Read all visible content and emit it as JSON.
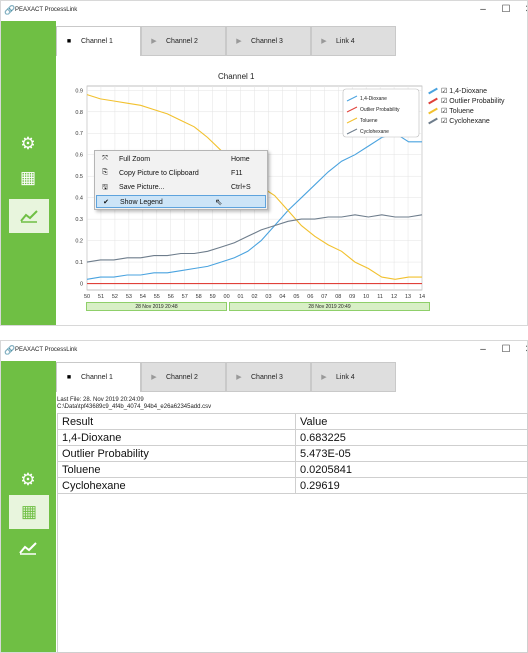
{
  "app_title": "PEAXACT ProcessLink",
  "window_controls": {
    "minimize": "–",
    "maximize": "☐",
    "close": "✕"
  },
  "sidebar": [
    {
      "name": "settings",
      "icon": "gear-icon",
      "glyph": "⚙"
    },
    {
      "name": "table",
      "icon": "table-icon",
      "glyph": "▦"
    },
    {
      "name": "chart",
      "icon": "chart-icon",
      "glyph": "⬈"
    }
  ],
  "tabs": [
    {
      "label": "Channel 1",
      "marker": "■"
    },
    {
      "label": "Channel 2",
      "marker": "▶"
    },
    {
      "label": "Channel 3",
      "marker": "▶"
    },
    {
      "label": "Link 4",
      "marker": "▶"
    }
  ],
  "chart_view": {
    "title": "Channel 1",
    "context_menu": [
      {
        "icon": "⤧",
        "label": "Full Zoom",
        "shortcut": "Home"
      },
      {
        "icon": "⎘",
        "label": "Copy Picture to Clipboard",
        "shortcut": "F11"
      },
      {
        "icon": "🖫",
        "label": "Save Picture...",
        "shortcut": "Ctrl+S"
      },
      {
        "icon": "✔",
        "label": "Show Legend",
        "shortcut": ""
      }
    ],
    "time_segments": [
      "28 Nov 2019 20:48",
      "28 Nov 2019 20:49"
    ],
    "side_legend_checkbox": "☑"
  },
  "chart_data": {
    "type": "line",
    "title": "Channel 1",
    "xlabel": "",
    "ylabel": "",
    "ylim": [
      -0.03,
      0.92
    ],
    "x_ticks": [
      "50",
      "51",
      "52",
      "53",
      "54",
      "55",
      "56",
      "57",
      "58",
      "59",
      "00",
      "01",
      "02",
      "03",
      "04",
      "05",
      "06",
      "07",
      "08",
      "09",
      "10",
      "11",
      "12",
      "13",
      "14"
    ],
    "y_ticks": [
      "0",
      "0.1",
      "0.2",
      "0.3",
      "0.4",
      "0.5",
      "0.6",
      "0.7",
      "0.8",
      "0.9"
    ],
    "grid": true,
    "legend_placement": "top-right",
    "series": [
      {
        "name": "1,4-Dioxane",
        "color": "#4aa3df",
        "values": [
          0.02,
          0.03,
          0.03,
          0.04,
          0.04,
          0.05,
          0.05,
          0.06,
          0.07,
          0.08,
          0.1,
          0.12,
          0.15,
          0.2,
          0.27,
          0.34,
          0.4,
          0.46,
          0.52,
          0.57,
          0.6,
          0.64,
          0.68,
          0.7,
          0.66,
          0.66
        ]
      },
      {
        "name": "Outlier Probability",
        "color": "#e0413a",
        "values": [
          0,
          0,
          0,
          0,
          0,
          0,
          0,
          0,
          0,
          0,
          0,
          0,
          0,
          0,
          0,
          0,
          0,
          0,
          0,
          0,
          0,
          0,
          0,
          0,
          0,
          0
        ]
      },
      {
        "name": "Toluene",
        "color": "#f2c12e",
        "values": [
          0.88,
          0.86,
          0.85,
          0.84,
          0.83,
          0.81,
          0.79,
          0.76,
          0.73,
          0.68,
          0.62,
          0.57,
          0.5,
          0.45,
          0.41,
          0.34,
          0.27,
          0.22,
          0.18,
          0.15,
          0.1,
          0.07,
          0.03,
          0.02,
          0.03,
          0.03
        ]
      },
      {
        "name": "Cyclohexane",
        "color": "#6e7d8c",
        "values": [
          0.1,
          0.11,
          0.11,
          0.12,
          0.12,
          0.13,
          0.13,
          0.14,
          0.14,
          0.15,
          0.17,
          0.19,
          0.22,
          0.25,
          0.27,
          0.29,
          0.3,
          0.3,
          0.31,
          0.31,
          0.32,
          0.31,
          0.32,
          0.31,
          0.31,
          0.32
        ]
      }
    ]
  },
  "table_view": {
    "last_file": "Last File: 28. Nov 2019 20:24:09",
    "path": "C:\\Data\\tpf43689c9_4f4b_4074_94b4_e26a62345add.csv",
    "headers": [
      "Result",
      "Value"
    ],
    "rows": [
      [
        "1,4-Dioxane",
        "0.683225"
      ],
      [
        "Outlier Probability",
        "5.473E-05"
      ],
      [
        "Toluene",
        "0.0205841"
      ],
      [
        "Cyclohexane",
        "0.29619"
      ]
    ]
  }
}
